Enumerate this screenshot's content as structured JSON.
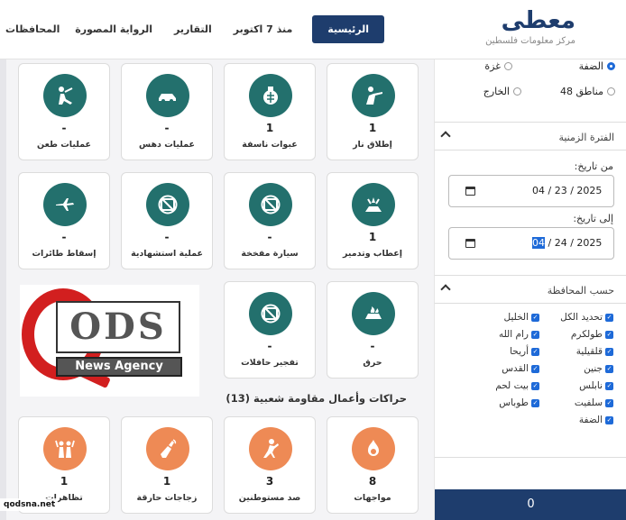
{
  "header": {
    "logo_title": "معطى",
    "logo_sub": "مركز معلومات فلسطين",
    "nav": [
      {
        "label": "الرئيسية",
        "active": true
      },
      {
        "label": "منذ 7 اكتوبر",
        "active": false
      },
      {
        "label": "التقارير",
        "active": false
      },
      {
        "label": "الرواية المصورة",
        "active": false
      },
      {
        "label": "المحافظات",
        "active": false
      }
    ]
  },
  "sidebar": {
    "regions": [
      {
        "label": "الضفة",
        "selected": true
      },
      {
        "label": "غزة",
        "selected": false
      },
      {
        "label": "مناطق 48",
        "selected": false
      },
      {
        "label": "الخارج",
        "selected": false
      }
    ],
    "time_section": "الفترة الزمنية",
    "from_label": "من تاريخ:",
    "from_date": "04 / 23 / 2025",
    "to_label": "إلى تاريخ:",
    "to_month": "04",
    "to_rest": " / 24 / 2025",
    "gov_section": "حسب المحافظة",
    "governorates": [
      "تحديد الكل",
      "الخليل",
      "طولكرم",
      "رام الله",
      "قلقيلية",
      "أريحا",
      "جنين",
      "القدس",
      "نابلس",
      "بيت لحم",
      "سلفيت",
      "طوباس",
      "الضفة"
    ],
    "counter": "0"
  },
  "cards": {
    "row1": [
      {
        "label": "إطلاق نار",
        "value": "1",
        "icon": "shooter-icon"
      },
      {
        "label": "عبوات ناسفة",
        "value": "1",
        "icon": "grenade-icon"
      },
      {
        "label": "عمليات دهس",
        "value": "-",
        "icon": "car-ramming-icon"
      },
      {
        "label": "عمليات طعن",
        "value": "-",
        "icon": "stabbing-icon"
      }
    ],
    "row2": [
      {
        "label": "إعطاب وتدمير",
        "value": "1",
        "icon": "destruction-icon"
      },
      {
        "label": "سيارة مفخخة",
        "value": "-",
        "icon": "no-image-icon"
      },
      {
        "label": "عملية استشهادية",
        "value": "-",
        "icon": "no-image-icon"
      },
      {
        "label": "إسقاط طائرات",
        "value": "-",
        "icon": "plane-down-icon"
      }
    ],
    "row3": [
      {
        "label": "حرق",
        "value": "-",
        "icon": "burning-icon"
      },
      {
        "label": "تفجير حافلات",
        "value": "-",
        "icon": "no-image-icon"
      }
    ],
    "section_title": "حراكات وأعمال مقاومة شعبية (13)",
    "row4": [
      {
        "label": "مواجهات",
        "value": "8",
        "icon": "fire-clash-icon"
      },
      {
        "label": "صد مستوطنين",
        "value": "3",
        "icon": "settler-repel-icon"
      },
      {
        "label": "زجاجات حارقة",
        "value": "1",
        "icon": "molotov-icon"
      },
      {
        "label": "تظاهرات",
        "value": "1",
        "icon": "protest-icon"
      }
    ]
  },
  "logo_image": {
    "line1": "ODS",
    "line2": "News Agency"
  },
  "watermark": "qodsna.net",
  "colors": {
    "primary": "#1e3d6d",
    "teal": "#23706d",
    "orange": "#ee8a55",
    "check": "#1e6ad8"
  }
}
